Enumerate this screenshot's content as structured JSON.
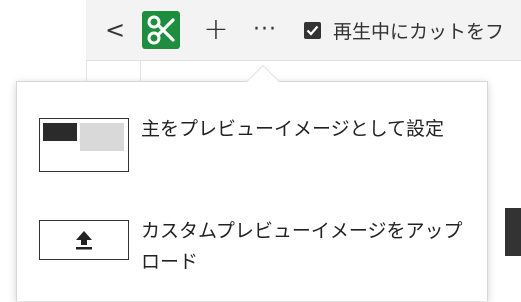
{
  "toolbar": {
    "back_icon": "chevron-left-icon",
    "back_glyph": "<",
    "cut_icon": "scissors-icon",
    "cut_icon_color": "#1e8e3e",
    "add_glyph": "+",
    "more_glyph": "···",
    "checkbox_checked": true,
    "checkbox_label": "再生中にカットをフ"
  },
  "menu": {
    "items": [
      {
        "icon": "preview-thumbnail-icon",
        "label": "主をプレビューイメージとして設定"
      },
      {
        "icon": "upload-icon",
        "label": "カスタムプレビューイメージをアップロード"
      }
    ]
  }
}
